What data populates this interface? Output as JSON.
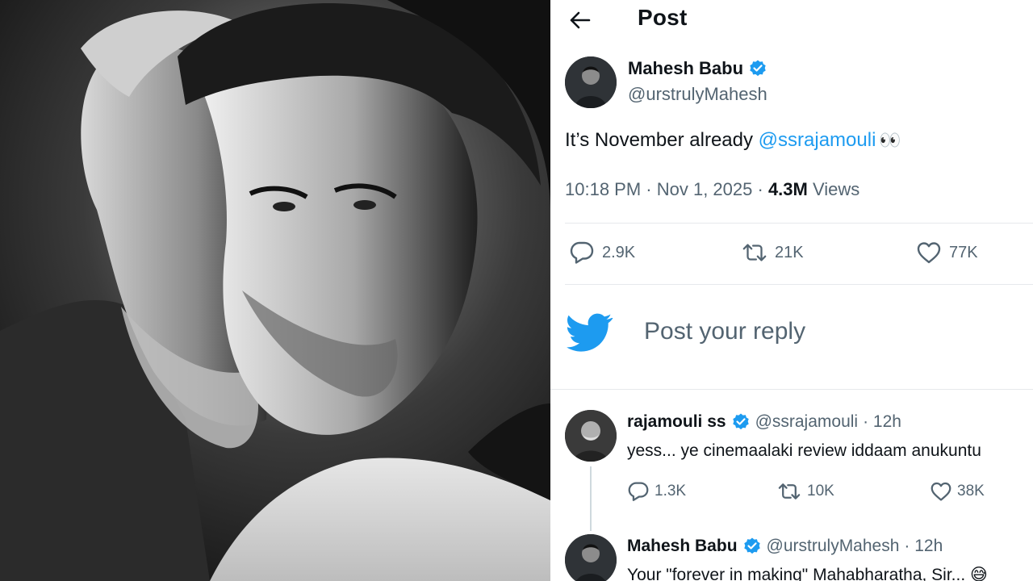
{
  "header": {
    "title": "Post"
  },
  "post": {
    "author_name": "Mahesh Babu",
    "author_handle": "@urstrulyMahesh",
    "text_before": "It’s November already ",
    "mention": "@ssrajamouli",
    "emoji": "👀",
    "time": "10:18 PM",
    "separator": " · ",
    "date": "Nov 1, 2025",
    "views_count": "4.3M",
    "views_label": " Views",
    "stats": {
      "replies": "2.9K",
      "reposts": "21K",
      "likes": "77K"
    }
  },
  "reply_box": {
    "placeholder": "Post your reply"
  },
  "replies": [
    {
      "author_name": "rajamouli ss",
      "author_handle": "@ssrajamouli",
      "time": "· 12h",
      "text": "yess... ye cinemaalaki review iddaam anukuntu",
      "stats": {
        "replies": "1.3K",
        "reposts": "10K",
        "likes": "38K"
      }
    },
    {
      "author_name": "Mahesh Babu",
      "author_handle": "@urstrulyMahesh",
      "time": "· 12h",
      "text": "Your \"forever in making\" Mahabharatha, Sir... 😅"
    }
  ],
  "colors": {
    "accent": "#1d9bf0",
    "text": "#0f1419",
    "muted": "#536471"
  },
  "icons": [
    "back-arrow-icon",
    "verified-badge-icon",
    "reply-icon",
    "repost-icon",
    "like-icon",
    "twitter-bird-icon"
  ]
}
